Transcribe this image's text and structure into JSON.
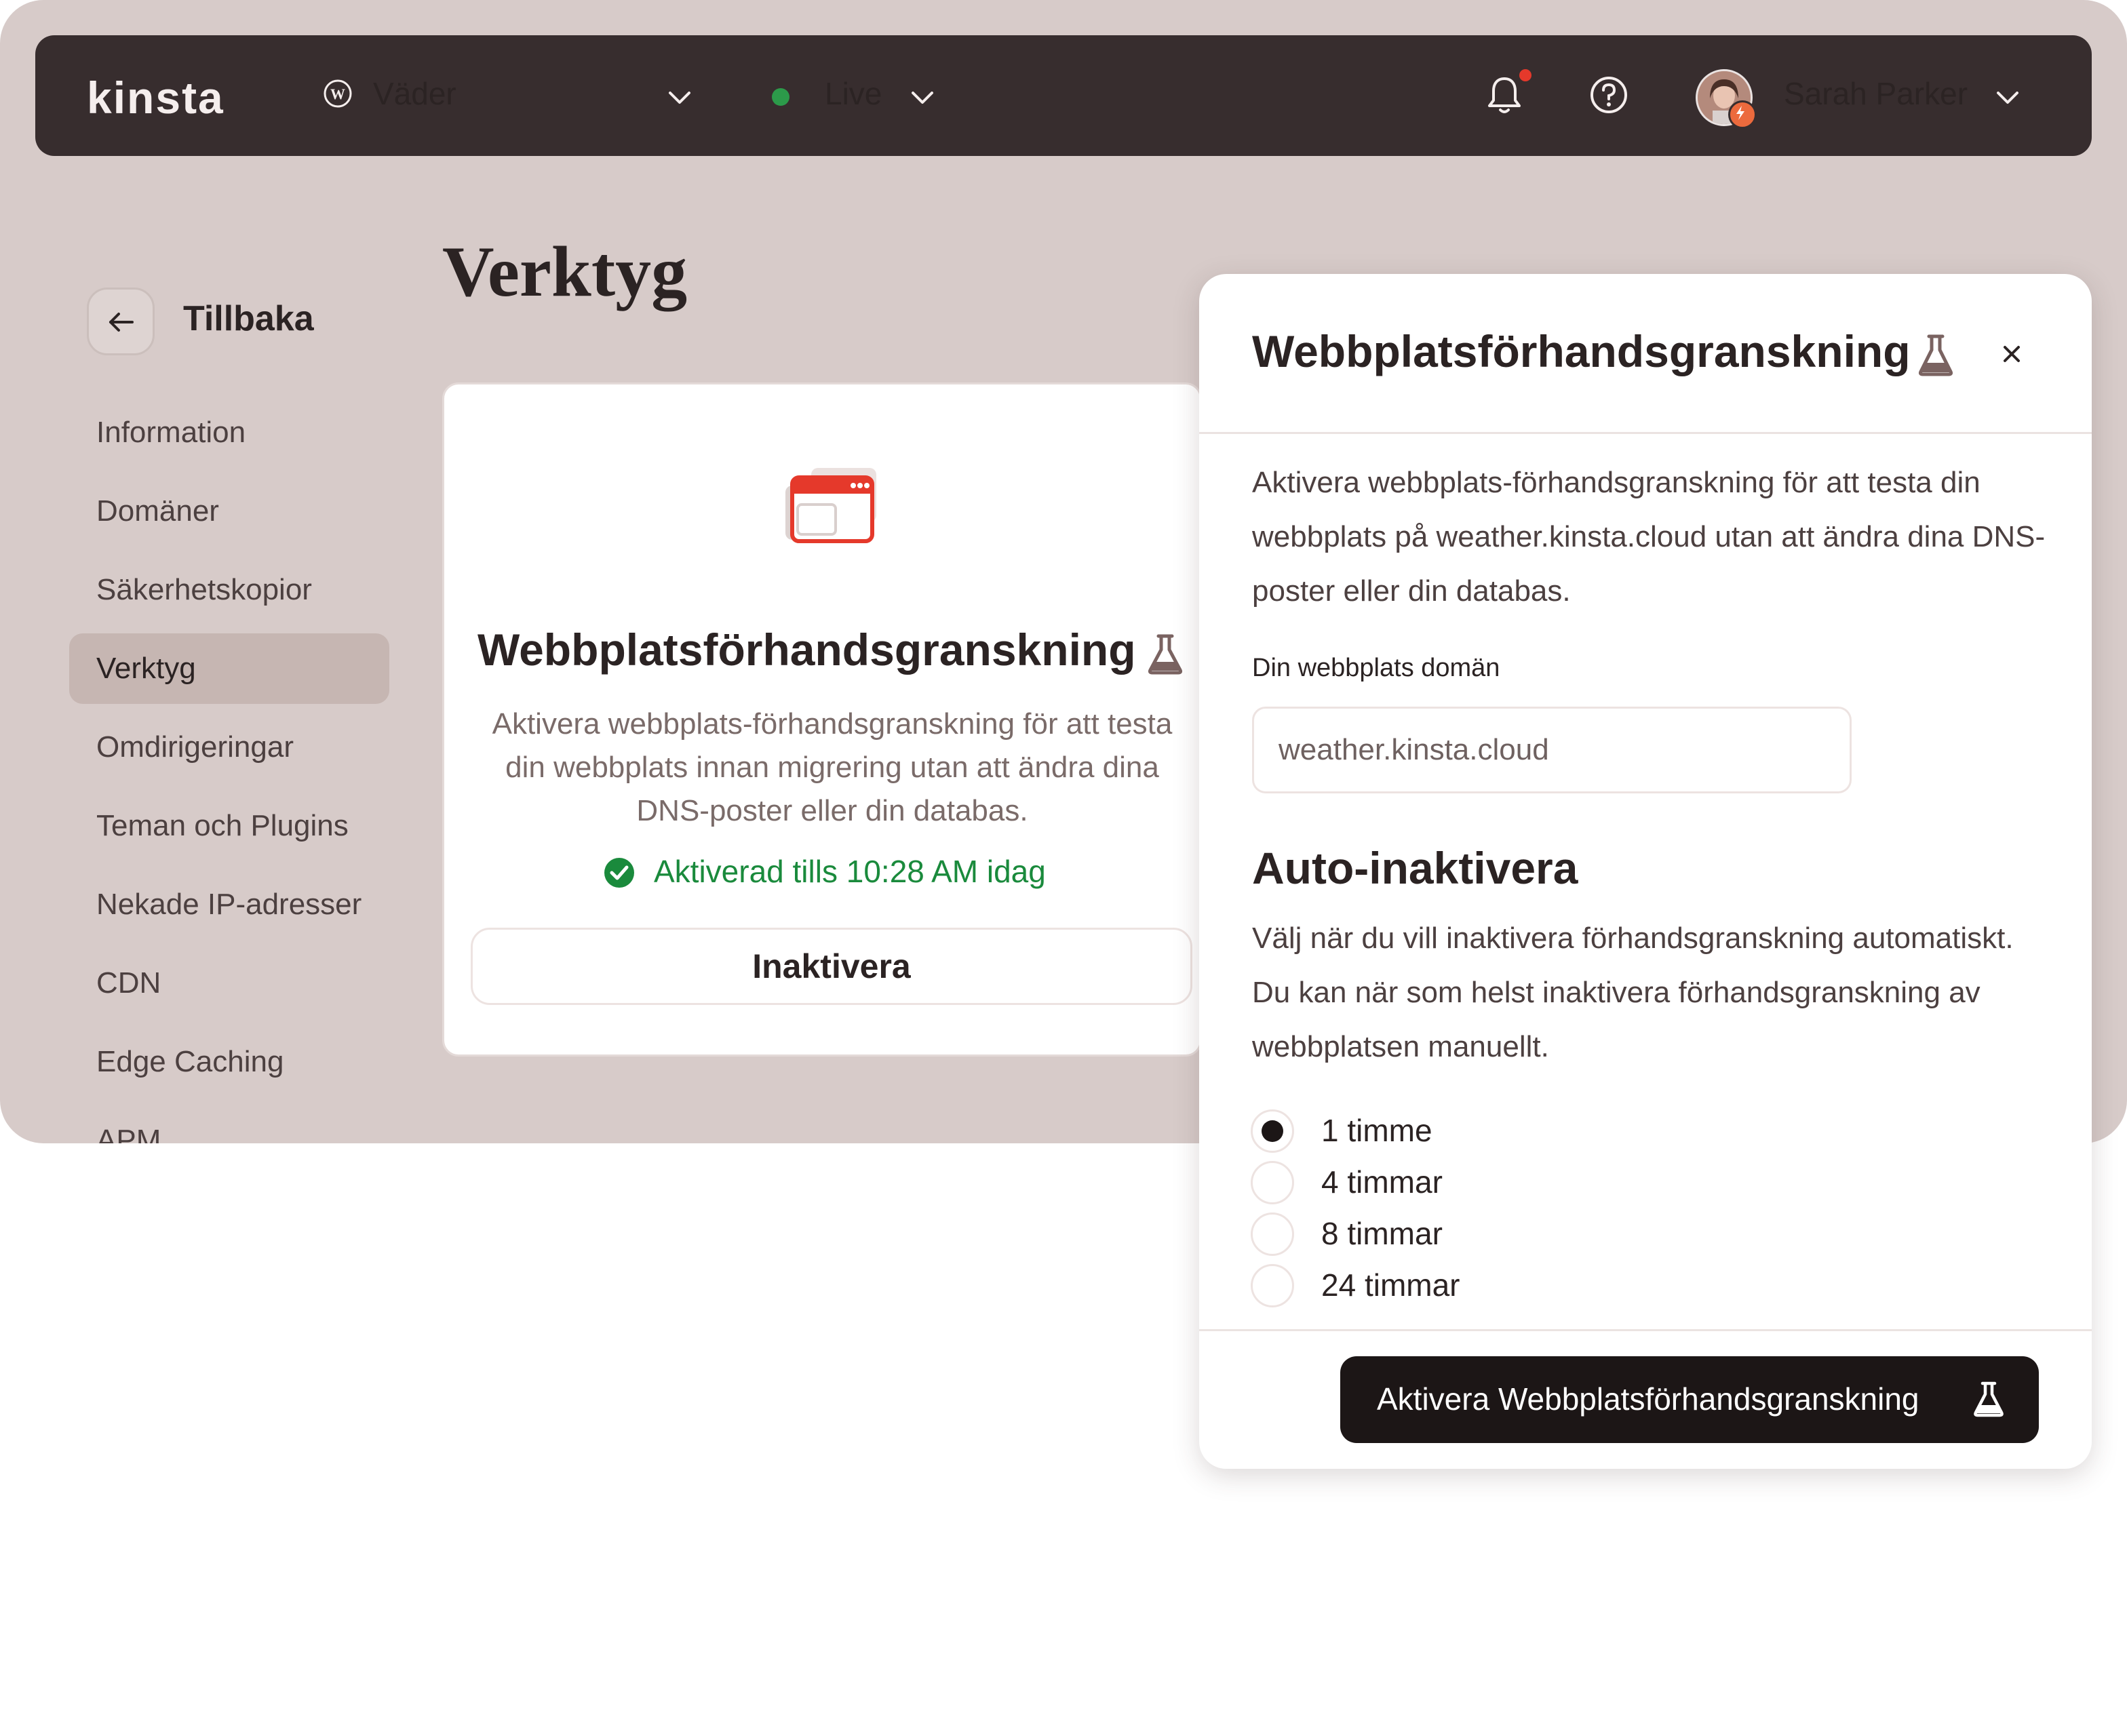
{
  "topbar": {
    "logo": "kinsta",
    "site_name": "Väder",
    "environment": "Live",
    "environment_color": "#2c9a4a",
    "user_name": "Sarah Parker",
    "notification_dot_color": "#e5392b",
    "icons": [
      "wordpress-icon",
      "chevron-down-icon",
      "bell-icon",
      "help-icon",
      "avatar",
      "chevron-down-icon"
    ]
  },
  "sidebar": {
    "back_label": "Tillbaka",
    "items": [
      {
        "label": "Information"
      },
      {
        "label": "Domäner"
      },
      {
        "label": "Säkerhetskopior"
      },
      {
        "label": "Verktyg",
        "active": true
      },
      {
        "label": "Omdirigeringar"
      },
      {
        "label": "Teman och Plugins"
      },
      {
        "label": "Nekade IP-adresser"
      },
      {
        "label": "CDN"
      },
      {
        "label": "Edge Caching"
      },
      {
        "label": "APM"
      }
    ]
  },
  "main": {
    "page_title": "Verktyg",
    "card": {
      "title": "Webbplatsförhandsgranskning",
      "description": "Aktivera webbplats-förhandsgranskning för att testa din webbplats innan migrering utan att ändra dina DNS-poster eller din databas.",
      "status": "Aktiverad tills 10:28 AM idag",
      "status_color": "#1a8a3c",
      "button_label": "Inaktivera"
    }
  },
  "panel": {
    "title": "Webbplatsförhandsgranskning",
    "description": "Aktivera webbplats-förhandsgranskning för att testa din webbplats på weather.kinsta.cloud utan att ändra dina DNS-poster eller din databas.",
    "domain_label": "Din webbplats domän",
    "domain_value": "weather.kinsta.cloud",
    "auto_title": "Auto-inaktivera",
    "auto_description": "Välj när du vill inaktivera förhandsgranskning automatiskt. Du kan när som helst inaktivera förhandsgranskning av webbplatsen manuellt.",
    "options": [
      {
        "label": "1 timme",
        "selected": true
      },
      {
        "label": "4 timmar",
        "selected": false
      },
      {
        "label": "8 timmar",
        "selected": false
      },
      {
        "label": "24 timmar",
        "selected": false
      }
    ],
    "primary_button": "Aktivera Webbplatsförhandsgranskning"
  }
}
